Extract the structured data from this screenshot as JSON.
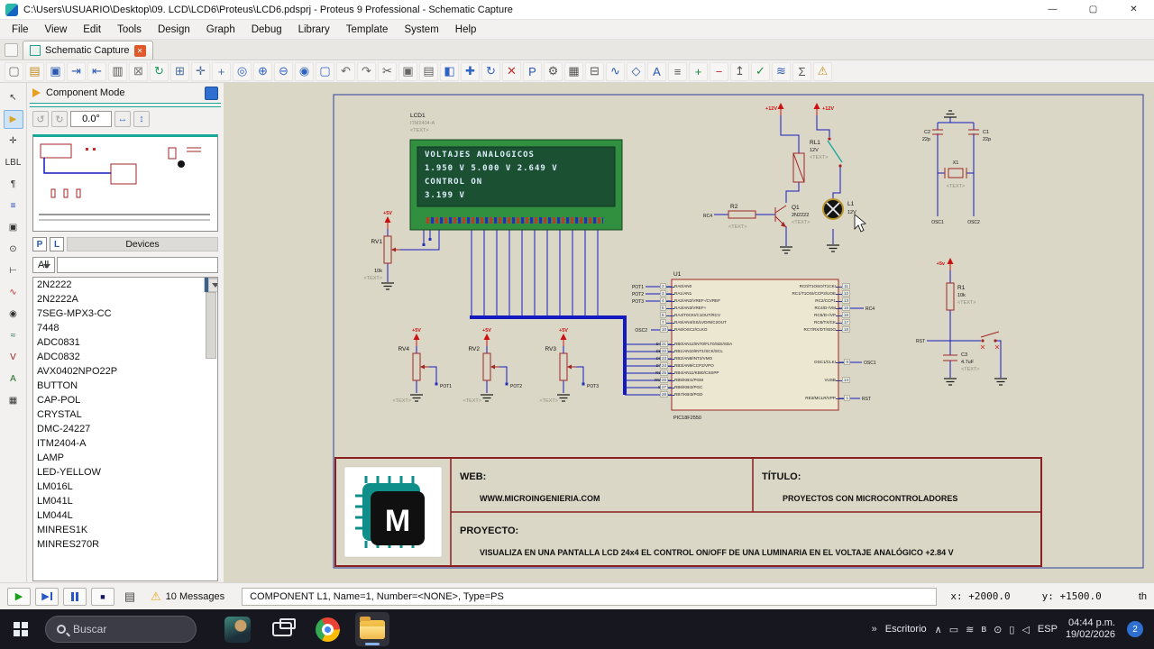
{
  "window": {
    "title": "C:\\Users\\USUARIO\\Desktop\\09. LCD\\LCD6\\Proteus\\LCD6.pdsprj - Proteus 9 Professional - Schematic Capture",
    "min_icon": "—",
    "max_icon": "▢",
    "close_icon": "✕"
  },
  "menu": {
    "items": [
      "File",
      "View",
      "Edit",
      "Tools",
      "Design",
      "Graph",
      "Debug",
      "Library",
      "Template",
      "System",
      "Help"
    ]
  },
  "tabs": {
    "active": "Schematic Capture",
    "close_icon": "✕"
  },
  "toolbar": {
    "icons": [
      {
        "n": "new-file-icon",
        "g": "▢",
        "c": "#6a6a6a"
      },
      {
        "n": "open-file-icon",
        "g": "▤",
        "c": "#c08a20"
      },
      {
        "n": "save-file-icon",
        "g": "▣",
        "c": "#2858b0"
      },
      {
        "n": "import-icon",
        "g": "⇥",
        "c": "#2858b0"
      },
      {
        "n": "export-icon",
        "g": "⇤",
        "c": "#2858b0"
      },
      {
        "n": "print-icon",
        "g": "▥",
        "c": "#555555"
      },
      {
        "n": "mark-area-icon",
        "g": "⊠",
        "c": "#777777"
      },
      {
        "n": "redraw-icon",
        "g": "↻",
        "c": "#1f9a5e"
      },
      {
        "n": "grid-toggle-icon",
        "g": "⊞",
        "c": "#49699f"
      },
      {
        "n": "origin-icon",
        "g": "✛",
        "c": "#49699f"
      },
      {
        "n": "cursor-snap-icon",
        "g": "+",
        "c": "#49699f"
      },
      {
        "n": "center-view-icon",
        "g": "◎",
        "c": "#2f62c4"
      },
      {
        "n": "zoom-in-icon",
        "g": "⊕",
        "c": "#2f62c4"
      },
      {
        "n": "zoom-out-icon",
        "g": "⊖",
        "c": "#2f62c4"
      },
      {
        "n": "zoom-all-icon",
        "g": "◉",
        "c": "#2f62c4"
      },
      {
        "n": "zoom-area-icon",
        "g": "▢",
        "c": "#2f62c4"
      },
      {
        "n": "undo-icon",
        "g": "↶",
        "c": "#666666"
      },
      {
        "n": "redo-icon",
        "g": "↷",
        "c": "#666666"
      },
      {
        "n": "cut-icon",
        "g": "✂",
        "c": "#555555"
      },
      {
        "n": "copy-icon",
        "g": "▣",
        "c": "#666666"
      },
      {
        "n": "paste-icon",
        "g": "▤",
        "c": "#666666"
      },
      {
        "n": "block-copy-icon",
        "g": "◧",
        "c": "#2f62c4"
      },
      {
        "n": "block-move-icon",
        "g": "✚",
        "c": "#2f62c4"
      },
      {
        "n": "block-rotate-icon",
        "g": "↻",
        "c": "#2f62c4"
      },
      {
        "n": "block-delete-icon",
        "g": "✕",
        "c": "#c23030"
      },
      {
        "n": "pick-parts-icon",
        "g": "P",
        "c": "#2858b0"
      },
      {
        "n": "make-device-icon",
        "g": "⚙",
        "c": "#555555"
      },
      {
        "n": "packaging-tool-icon",
        "g": "▦",
        "c": "#555555"
      },
      {
        "n": "decompose-icon",
        "g": "⊟",
        "c": "#555555"
      },
      {
        "n": "wire-autorouter-icon",
        "g": "∿",
        "c": "#2858b0"
      },
      {
        "n": "search-tag-icon",
        "g": "◇",
        "c": "#2858b0"
      },
      {
        "n": "property-assignment-icon",
        "g": "A",
        "c": "#2858b0"
      },
      {
        "n": "design-explorer-icon",
        "g": "≡",
        "c": "#555555"
      },
      {
        "n": "new-sheet-icon",
        "g": "+",
        "c": "#1f8a3f"
      },
      {
        "n": "remove-sheet-icon",
        "g": "−",
        "c": "#c23030"
      },
      {
        "n": "exit-sheet-icon",
        "g": "↥",
        "c": "#555555"
      },
      {
        "n": "electrical-rule-check-icon",
        "g": "✓",
        "c": "#1f8a3f"
      },
      {
        "n": "netlist-icon",
        "g": "≋",
        "c": "#2858b0"
      },
      {
        "n": "bill-of-materials-icon",
        "g": "Σ",
        "c": "#555555"
      },
      {
        "n": "simulation-log-icon",
        "g": "⚠",
        "c": "#d09020"
      }
    ]
  },
  "left_toolbar": {
    "icons": [
      {
        "n": "selection-mode-icon",
        "g": "↖",
        "c": "#333333"
      },
      {
        "n": "component-mode-icon",
        "g": "▶",
        "c": "#d9a520"
      },
      {
        "n": "junction-dot-icon",
        "g": "✛",
        "c": "#333333"
      },
      {
        "n": "wire-label-icon",
        "g": "LBL",
        "c": "#333333"
      },
      {
        "n": "text-script-icon",
        "g": "¶",
        "c": "#333333"
      },
      {
        "n": "buses-icon",
        "g": "≡",
        "c": "#2040c0"
      },
      {
        "n": "subcircuit-icon",
        "g": "▣",
        "c": "#333333"
      },
      {
        "n": "terminals-icon",
        "g": "⊙",
        "c": "#333333"
      },
      {
        "n": "device-pins-icon",
        "g": "⊢",
        "c": "#333333"
      },
      {
        "n": "graph-mode-icon",
        "g": "∿",
        "c": "#c03030"
      },
      {
        "n": "tape-recorder-icon",
        "g": "◉",
        "c": "#333333"
      },
      {
        "n": "generator-icon",
        "g": "≈",
        "c": "#207050"
      },
      {
        "n": "voltage-probe-icon",
        "g": "V",
        "c": "#a02020"
      },
      {
        "n": "current-probe-icon",
        "g": "A",
        "c": "#207020"
      },
      {
        "n": "virtual-instruments-icon",
        "g": "▦",
        "c": "#333333"
      }
    ]
  },
  "sidebar": {
    "mode_title": "Component Mode",
    "rotation": "0.0°",
    "undo_icon": "↺",
    "redo_icon": "↻",
    "mirror_h_icon": "↔",
    "mirror_v_icon": "↕",
    "pick": "P",
    "library": "L",
    "devices": "Devices",
    "filter": "All",
    "components": [
      "2N2222",
      "2N2222A",
      "7SEG-MPX3-CC",
      "7448",
      "ADC0831",
      "ADC0832",
      "AVX0402NPO22P",
      "BUTTON",
      "CAP-POL",
      "CRYSTAL",
      "DMC-24227",
      "ITM2404-A",
      "LAMP",
      "LED-YELLOW",
      "LM016L",
      "LM041L",
      "LM044L",
      "MINRES1K",
      "MINRES270R"
    ]
  },
  "schematic": {
    "placeholder": "<TEXT>",
    "lcd": {
      "ref": "LCD1",
      "model": "ITM2404-A",
      "lines": [
        "VOLTAJES ANALOGICOS",
        "1.950 V 5.000 V 2.649 V",
        "CONTROL ON",
        "3.199 V"
      ]
    },
    "u1": {
      "ref": "U1",
      "value": "PIC18F2550",
      "left_a": [
        {
          "num": "2",
          "label": "RA0/AN0"
        },
        {
          "num": "3",
          "label": "RA1/AN1"
        },
        {
          "num": "4",
          "label": "RA2/AN2/VREF-/CVREF"
        },
        {
          "num": "5",
          "label": "RA3/AN3/VREF+"
        },
        {
          "num": "6",
          "label": "RA4/T0CKI/C1OUT/RCV"
        },
        {
          "num": "7",
          "label": "RA5/AN4/SS/LVDIN/C2OUT"
        },
        {
          "num": "10",
          "label": "RA6/OSC2/CLKO"
        }
      ],
      "left_b": [
        {
          "num": "21",
          "label": "RB0/AN12/INT0/FLT0/SDI/SDA"
        },
        {
          "num": "22",
          "label": "RB1/AN10/INT1/SCK/SCL"
        },
        {
          "num": "23",
          "label": "RB2/AN8/INT2/VMO"
        },
        {
          "num": "24",
          "label": "RB3/AN9/CCP2/VPO"
        },
        {
          "num": "25",
          "label": "RB4/AN11/KBI0/CSSPP"
        },
        {
          "num": "26",
          "label": "RB5/KBI1/PGM"
        },
        {
          "num": "27",
          "label": "RB6/KBI2/PGC"
        },
        {
          "num": "28",
          "label": "RB7/KBI3/PGD"
        }
      ],
      "right_a": [
        {
          "num": "11",
          "label": "RC0/T1OSO/T1CKI"
        },
        {
          "num": "12",
          "label": "RC1/T1OSI/CCP2/UOE"
        },
        {
          "num": "13",
          "label": "RC2/CCP1"
        },
        {
          "num": "15",
          "label": "RC4/D-/VM"
        },
        {
          "num": "16",
          "label": "RC5/D+/VP"
        },
        {
          "num": "17",
          "label": "RC6/TX/CK"
        },
        {
          "num": "18",
          "label": "RC7/RX/DT/SDO"
        }
      ],
      "right_b": [
        {
          "num": "9",
          "label": "OSC1/CLKI"
        },
        {
          "num": "14",
          "label": "VUSB"
        },
        {
          "num": "1",
          "label": "RE3/MCLR/VPP"
        }
      ]
    },
    "bus_labels": [
      "D4",
      "D5",
      "D6",
      "D7",
      "RS",
      "RW",
      "E"
    ],
    "labels": {
      "pot1": "POT1",
      "pot2": "POT2",
      "pot3": "POT3",
      "osc1": "OSC1",
      "osc2": "OSC2",
      "rc4": "RC4",
      "rst": "RST",
      "p5": "+5V",
      "p5l": "+5v",
      "p12": "+12V"
    },
    "parts": {
      "rv1": {
        "ref": "RV1",
        "value": "10k"
      },
      "rv2": {
        "ref": "RV2"
      },
      "rv3": {
        "ref": "RV3"
      },
      "rv4": {
        "ref": "RV4"
      },
      "q1": {
        "ref": "Q1",
        "value": "2N2222"
      },
      "r2": {
        "ref": "R2"
      },
      "rl1": {
        "ref": "RL1",
        "value": "12V"
      },
      "l1": {
        "ref": "L1",
        "value": "12V"
      },
      "c1": {
        "ref": "C1",
        "value": "22p"
      },
      "c2": {
        "ref": "C2",
        "value": "22p"
      },
      "x1": {
        "ref": "X1"
      },
      "r1": {
        "ref": "R1",
        "value": "10k"
      },
      "c3": {
        "ref": "C3",
        "value": "4.7uF"
      }
    },
    "title_block": {
      "logo": "M",
      "web_label": "WEB:",
      "web": "WWW.MICROINGENIERIA.COM",
      "titulo_label": "TÍTULO:",
      "titulo": "PROYECTOS CON MICROCONTROLADORES",
      "proyecto_label": "PROYECTO:",
      "proyecto": "VISUALIZA EN UNA PANTALLA LCD 24x4 EL CONTROL ON/OFF DE UNA LUMINARIA EN EL VOLTAJE ANALÓGICO +2.84 V"
    }
  },
  "status": {
    "play_icon": "▶",
    "step_icon": "▶",
    "stop_icon": "■",
    "keyboard_icon": "▤",
    "warn_icon": "⚠",
    "messages": "10 Messages",
    "info": "COMPONENT L1, Name=1, Number=<NONE>, Type=PS",
    "x": "x: +2000.0",
    "y": "y: +1500.0",
    "units": "th"
  },
  "taskbar": {
    "search": "Buscar",
    "chevron": "»",
    "escritorio": "Escritorio",
    "tray": [
      {
        "n": "chevron-up-icon",
        "g": "∧"
      },
      {
        "n": "display-icon",
        "g": "▭"
      },
      {
        "n": "network-icon",
        "g": "≋"
      },
      {
        "n": "bluetooth-icon",
        "g": "ʙ"
      },
      {
        "n": "mic-icon",
        "g": "⊙"
      },
      {
        "n": "battery-icon",
        "g": "▯"
      },
      {
        "n": "volume-icon",
        "g": "◁"
      }
    ],
    "lang": "ESP",
    "time": "04:44 p.m.",
    "date": "19/02/2026",
    "badge": "2"
  }
}
